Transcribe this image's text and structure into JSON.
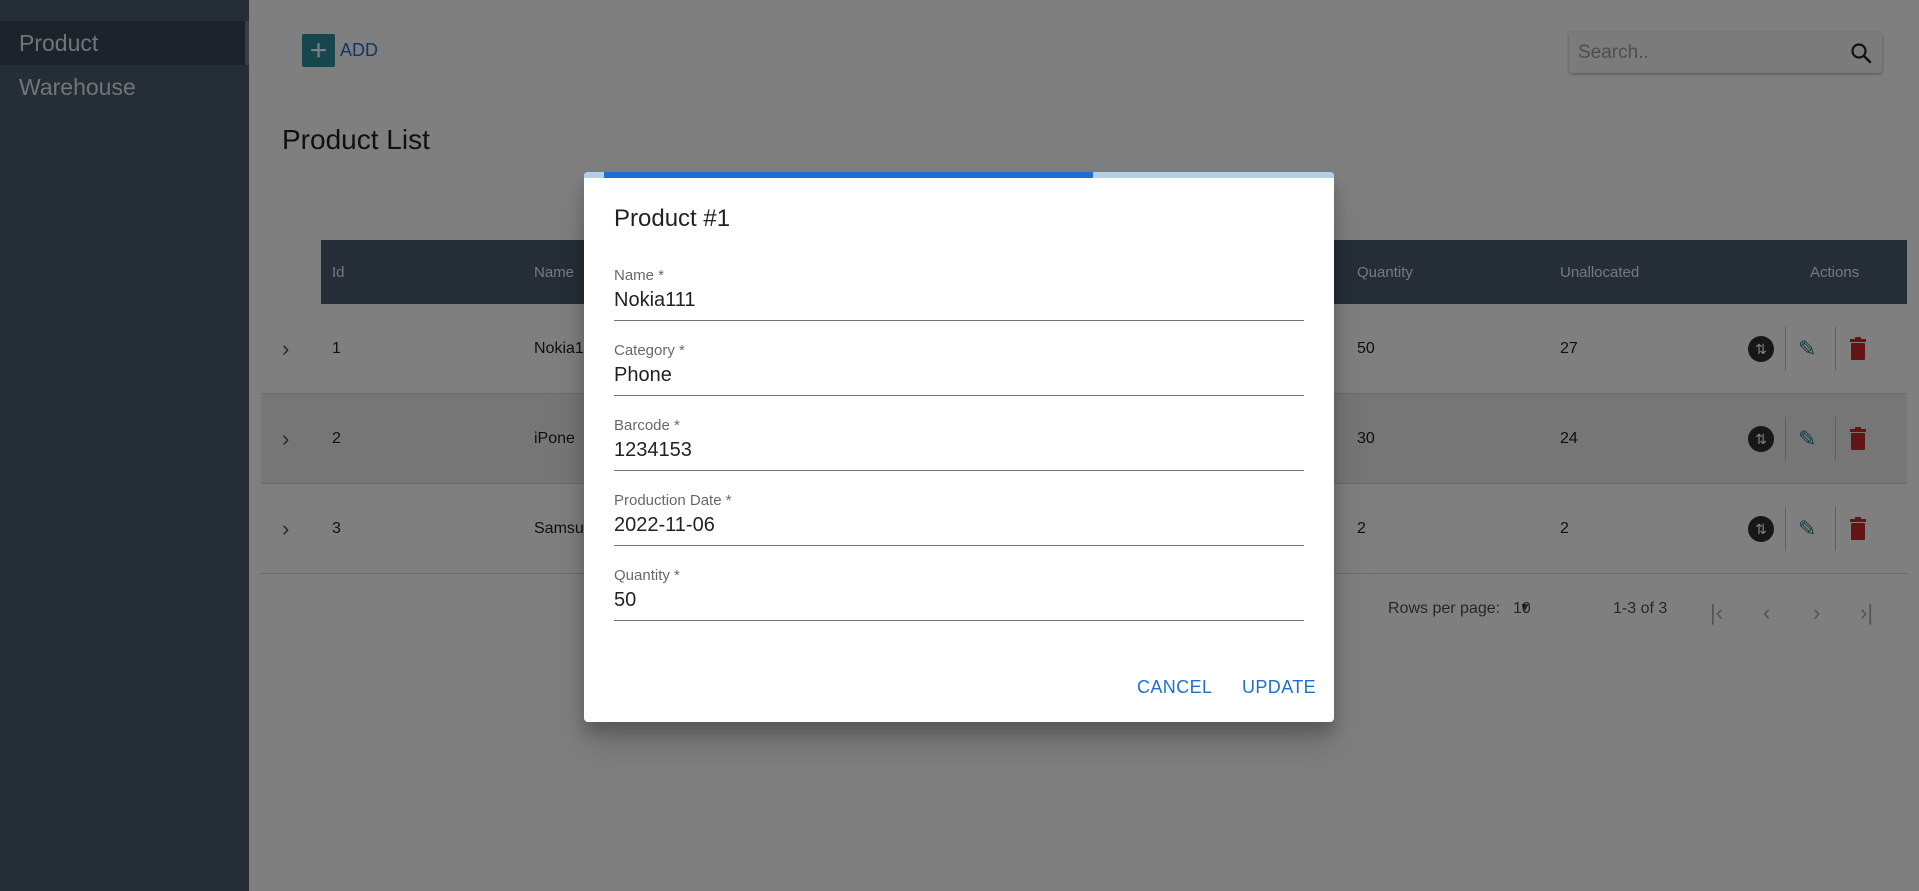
{
  "sidebar": {
    "items": [
      {
        "label": "Product"
      },
      {
        "label": "Warehouse"
      }
    ]
  },
  "toolbar": {
    "add_label": "ADD",
    "search_placeholder": "Search.."
  },
  "page": {
    "title": "Product List"
  },
  "table": {
    "columns": [
      "Id",
      "Name",
      "Quantity",
      "Unallocated",
      "Actions"
    ],
    "rows": [
      {
        "id": "1",
        "name": "Nokia1",
        "quantity": "50",
        "unallocated": "27"
      },
      {
        "id": "2",
        "name": "iPone",
        "quantity": "30",
        "unallocated": "24"
      },
      {
        "id": "3",
        "name": "Samsu",
        "quantity": "2",
        "unallocated": "2"
      }
    ]
  },
  "pagination": {
    "rows_per_page_label": "Rows per page:",
    "rows_per_page_value": "10",
    "range_label": "1-3 of 3"
  },
  "dialog": {
    "title": "Product #1",
    "progress_fraction": 0.67,
    "fields": [
      {
        "label": "Name *",
        "value": "Nokia111"
      },
      {
        "label": "Category *",
        "value": "Phone"
      },
      {
        "label": "Barcode *",
        "value": "1234153"
      },
      {
        "label": "Production Date *",
        "value": "2022-11-06"
      },
      {
        "label": "Quantity *",
        "value": "50"
      }
    ],
    "cancel_label": "CANCEL",
    "update_label": "UPDATE"
  },
  "colors": {
    "sidebar_bg": "#4a5a6d",
    "accent": "#1e6fcf",
    "delete": "#c62828",
    "edit": "#267f89"
  }
}
